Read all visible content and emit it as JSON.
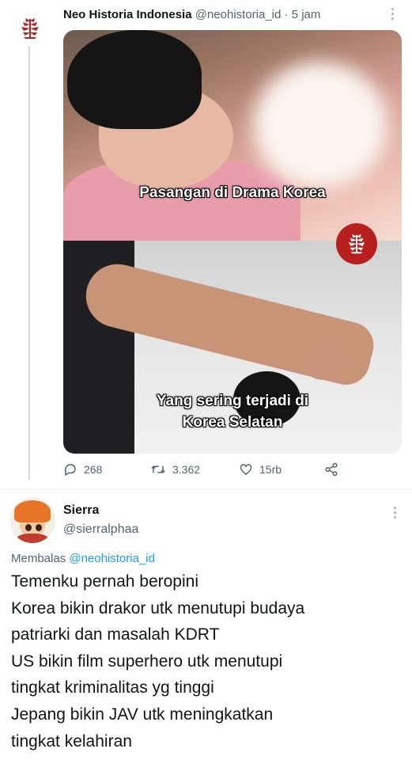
{
  "tweet": {
    "author_name": "Neo Historia Indonesia",
    "author_handle": "@neohistoria_id",
    "separator": " · ",
    "time": "5 jam",
    "image": {
      "caption_top": "Pasangan di Drama Korea",
      "caption_bottom_line1": "Yang sering terjadi di",
      "caption_bottom_line2": "Korea Selatan"
    },
    "actions": {
      "replies": "268",
      "retweets": "3.362",
      "likes": "15rb"
    }
  },
  "reply": {
    "author_name": "Sierra",
    "author_handle": "@sierralphaa",
    "replying_prefix": "Membalas ",
    "replying_to": "@neohistoria_id",
    "body_lines": [
      "Temenku pernah beropini",
      "Korea bikin drakor utk menutupi budaya",
      "patriarki dan masalah KDRT",
      "US bikin film superhero utk menutupi",
      "tingkat kriminalitas yg tinggi",
      "Jepang bikin JAV utk meningkatkan",
      "tingkat kelahiran"
    ]
  },
  "colors": {
    "brand_red": "#b6211f",
    "link_blue": "#1d9bf0",
    "secondary_text": "#536471"
  },
  "icons": [
    "neohistoria-logo-icon",
    "reply-icon",
    "retweet-icon",
    "like-icon",
    "share-icon",
    "more-icon"
  ]
}
